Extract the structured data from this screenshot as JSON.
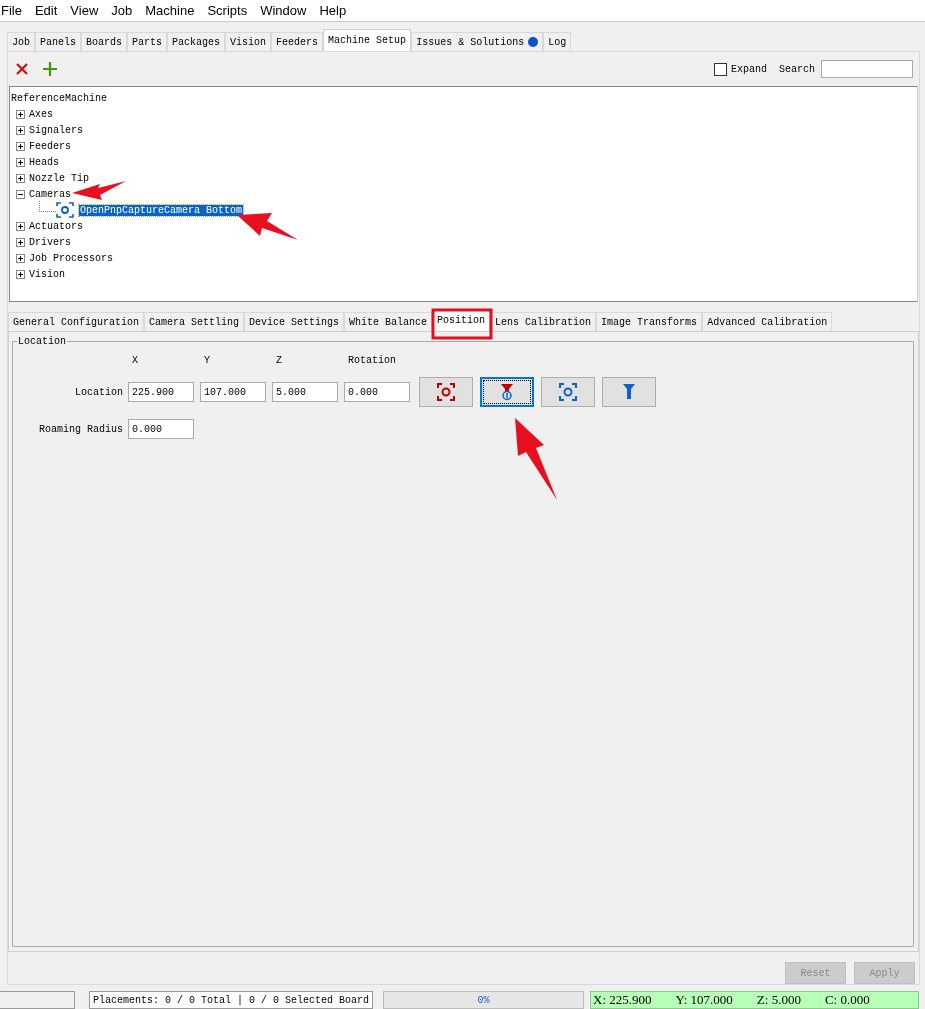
{
  "menu": [
    "File",
    "Edit",
    "View",
    "Job",
    "Machine",
    "Scripts",
    "Window",
    "Help"
  ],
  "tabs": [
    {
      "label": "Job",
      "selected": false,
      "indicator": false
    },
    {
      "label": "Panels",
      "selected": false,
      "indicator": false
    },
    {
      "label": "Boards",
      "selected": false,
      "indicator": false
    },
    {
      "label": "Parts",
      "selected": false,
      "indicator": false
    },
    {
      "label": "Packages",
      "selected": false,
      "indicator": false
    },
    {
      "label": "Vision",
      "selected": false,
      "indicator": false
    },
    {
      "label": "Feeders",
      "selected": false,
      "indicator": false
    },
    {
      "label": "Machine Setup",
      "selected": true,
      "indicator": false
    },
    {
      "label": "Issues & Solutions",
      "selected": false,
      "indicator": true
    },
    {
      "label": "Log",
      "selected": false,
      "indicator": false
    }
  ],
  "toolbar": {
    "expand": {
      "label": "Expand",
      "checked": false
    },
    "search_label": "Search"
  },
  "tree": {
    "root": "ReferenceMachine",
    "children": [
      {
        "label": "Axes",
        "expanded": false
      },
      {
        "label": "Signalers",
        "expanded": false
      },
      {
        "label": "Feeders",
        "expanded": false
      },
      {
        "label": "Heads",
        "expanded": false
      },
      {
        "label": "Nozzle Tip",
        "expanded": false
      },
      {
        "label": "Cameras",
        "expanded": true,
        "children": [
          {
            "label": "OpenPnpCaptureCamera Bottom",
            "selected": true
          }
        ]
      },
      {
        "label": "Actuators",
        "expanded": false
      },
      {
        "label": "Drivers",
        "expanded": false
      },
      {
        "label": "Job Processors",
        "expanded": false
      },
      {
        "label": "Vision",
        "expanded": false
      }
    ]
  },
  "sub_tabs": [
    {
      "label": "General Configuration",
      "selected": false
    },
    {
      "label": "Camera Settling",
      "selected": false
    },
    {
      "label": "Device Settings",
      "selected": false
    },
    {
      "label": "White Balance",
      "selected": false
    },
    {
      "label": "Position",
      "selected": true
    },
    {
      "label": "Lens Calibration",
      "selected": false
    },
    {
      "label": "Image Transforms",
      "selected": false
    },
    {
      "label": "Advanced Calibration",
      "selected": false
    }
  ],
  "location": {
    "title": "Location",
    "columns": [
      "X",
      "Y",
      "Z",
      "Rotation"
    ],
    "label": "Location",
    "values": [
      "225.900",
      "107.000",
      "5.000",
      "0.000"
    ],
    "buttons": [
      {
        "kind": "capture-camera",
        "focused": false
      },
      {
        "kind": "capture-tool",
        "focused": true
      },
      {
        "kind": "move-camera",
        "focused": false
      },
      {
        "kind": "move-tool",
        "focused": false
      }
    ],
    "radius_label": "Roaming Radius",
    "radius_value": "0.000"
  },
  "actions": [
    {
      "label": "Reset",
      "disabled": true
    },
    {
      "label": "Apply",
      "disabled": true
    }
  ],
  "status_bar": {
    "placements": "Placements: 0 / 0 Total | 0 / 0 Selected Board",
    "progress": {
      "level": 0,
      "reading": "0%"
    },
    "dro": [
      "X: 225.900",
      "Y: 107.000",
      "Z: 5.000",
      "C: 0.000"
    ]
  }
}
